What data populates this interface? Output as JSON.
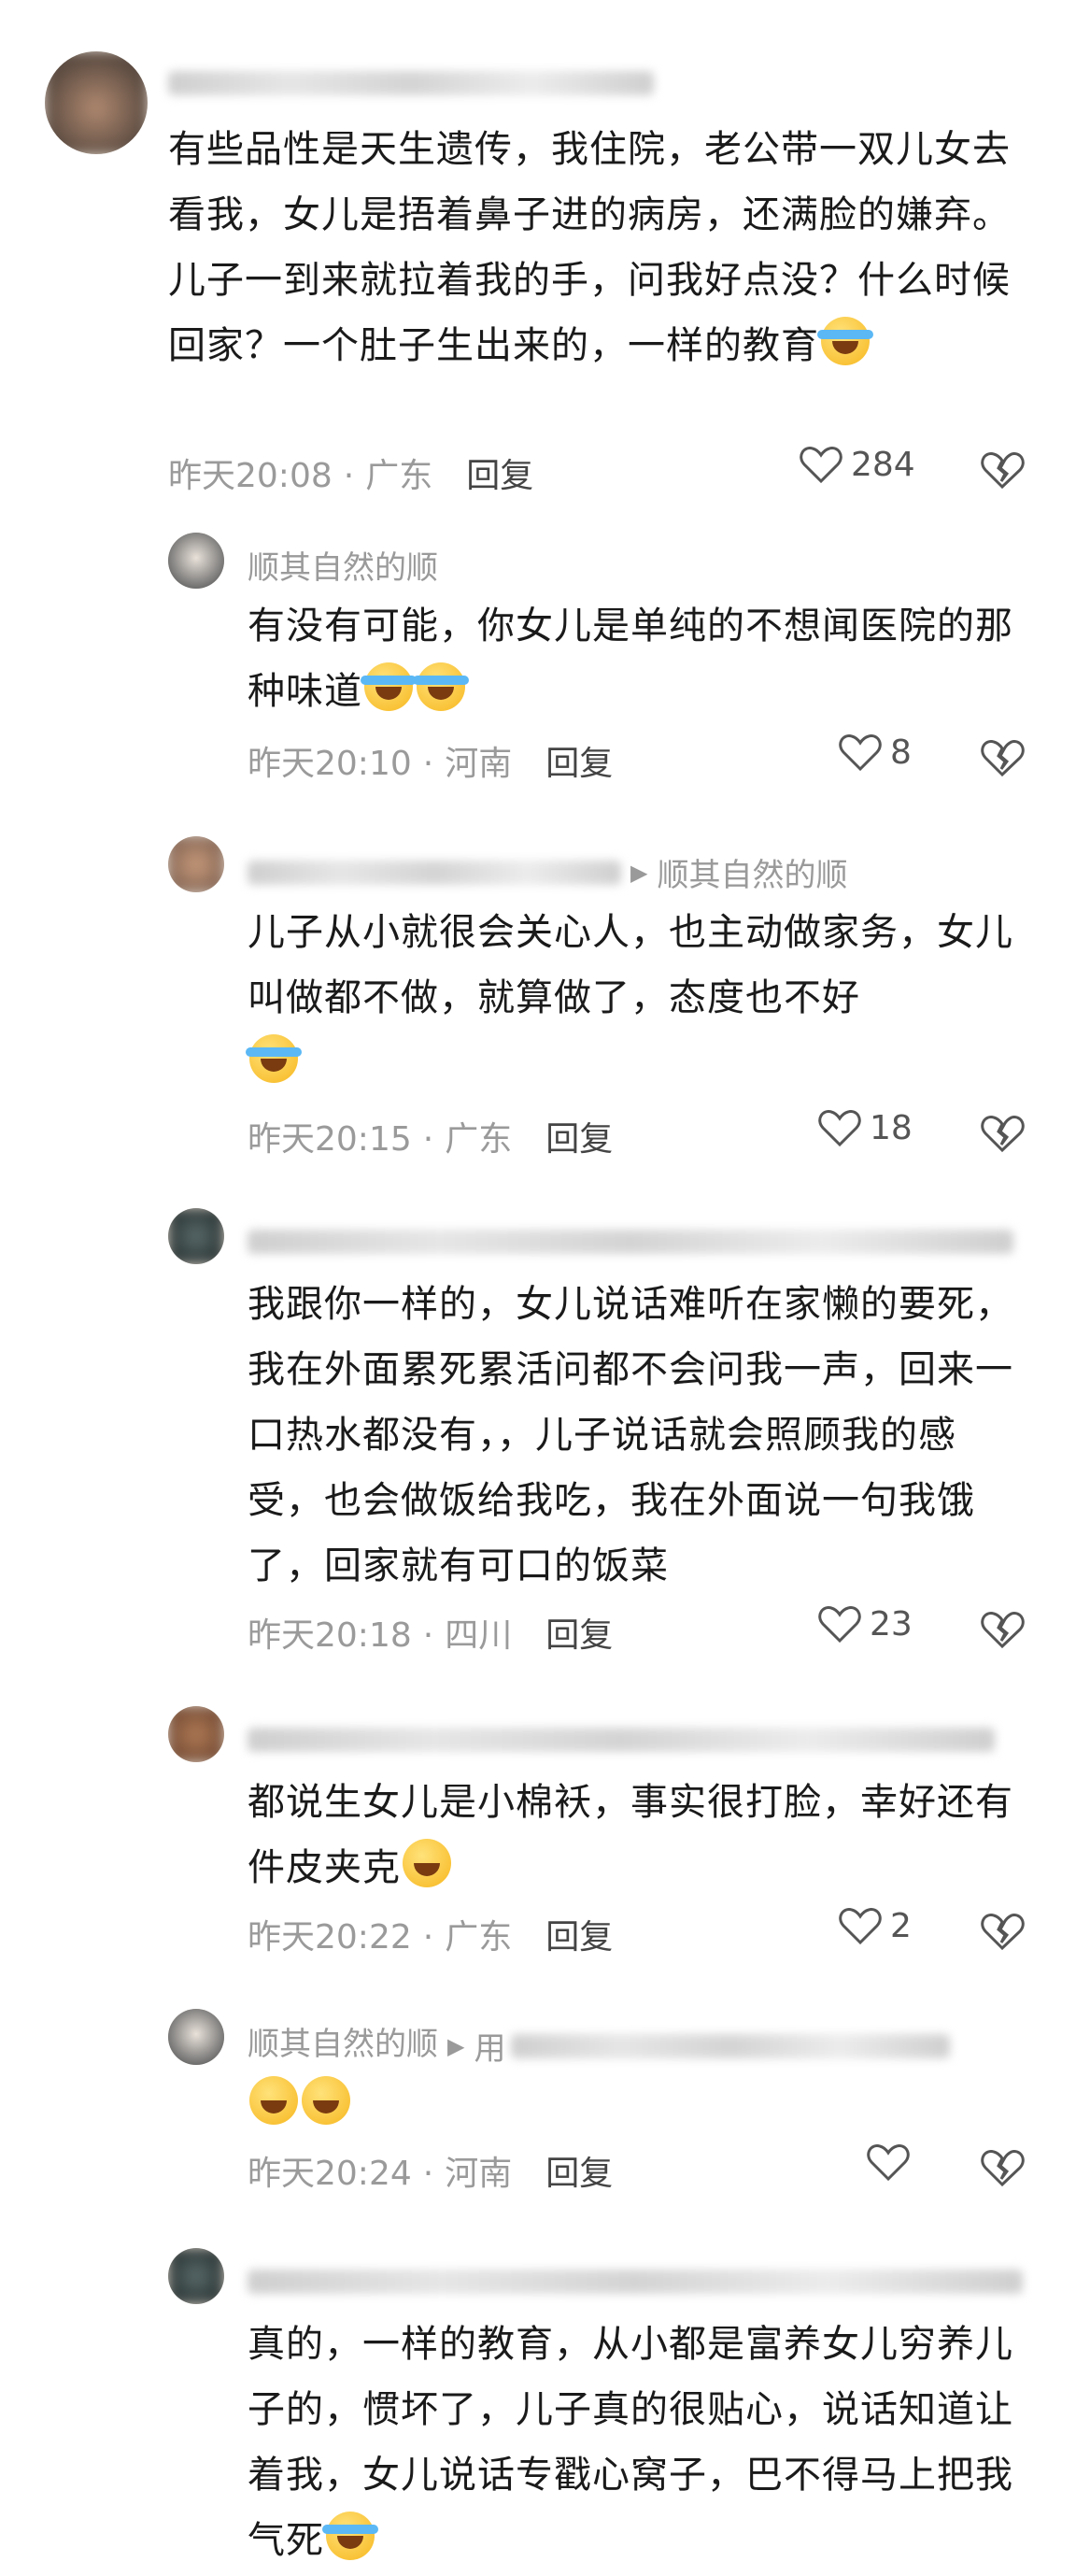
{
  "comments": [
    {
      "name_prefix": "",
      "text": "有些品性是天生遗传，我住院，老公带一双儿女去看我，女儿是捂着鼻子进的病房，还满脸的嫌弃。儿子一到来就拉着我的手，问我好点没？什么时候回家？一个肚子生出来的，一样的教育",
      "time": "昨天20:08",
      "region": "广东",
      "reply_label": "回复",
      "likes": "284"
    },
    {
      "name": "顺其自然的顺",
      "text": "有没有可能，你女儿是单纯的不想闻医院的那种味道",
      "time": "昨天20:10",
      "region": "河南",
      "reply_label": "回复",
      "likes": "8"
    },
    {
      "reply_to": "顺其自然的顺",
      "text": "儿子从小就很会关心人，也主动做家务，女儿叫做都不做，就算做了，态度也不好",
      "time": "昨天20:15",
      "region": "广东",
      "reply_label": "回复",
      "likes": "18"
    },
    {
      "text": "我跟你一样的，女儿说话难听在家懒的要死，我在外面累死累活问都不会问我一声，回来一口热水都没有，，儿子说话就会照顾我的感受，也会做饭给我吃，我在外面说一句我饿了，回家就有可口的饭菜",
      "time": "昨天20:18",
      "region": "四川",
      "reply_label": "回复",
      "likes": "23"
    },
    {
      "text": "都说生女儿是小棉袄，事实很打脸，幸好还有件皮夹克",
      "time": "昨天20:22",
      "region": "广东",
      "reply_label": "回复",
      "likes": "2"
    },
    {
      "name": "顺其自然的顺",
      "reply_to_prefix": "用",
      "text": "",
      "time": "昨天20:24",
      "region": "河南",
      "reply_label": "回复",
      "likes": ""
    },
    {
      "text": "真的，一样的教育，从小都是富养女儿穷养儿子的，惯坏了，儿子真的很贴心，说话知道让着我，女儿说话专戳心窝子，巴不得马上把我气死"
    }
  ],
  "colors": {
    "text": "#1a1a1a",
    "meta": "#9a9a9a",
    "background": "#ffffff"
  },
  "icons": {
    "like": "heart-icon",
    "dislike": "broken-heart-icon",
    "arrow": "play-arrow-icon"
  }
}
